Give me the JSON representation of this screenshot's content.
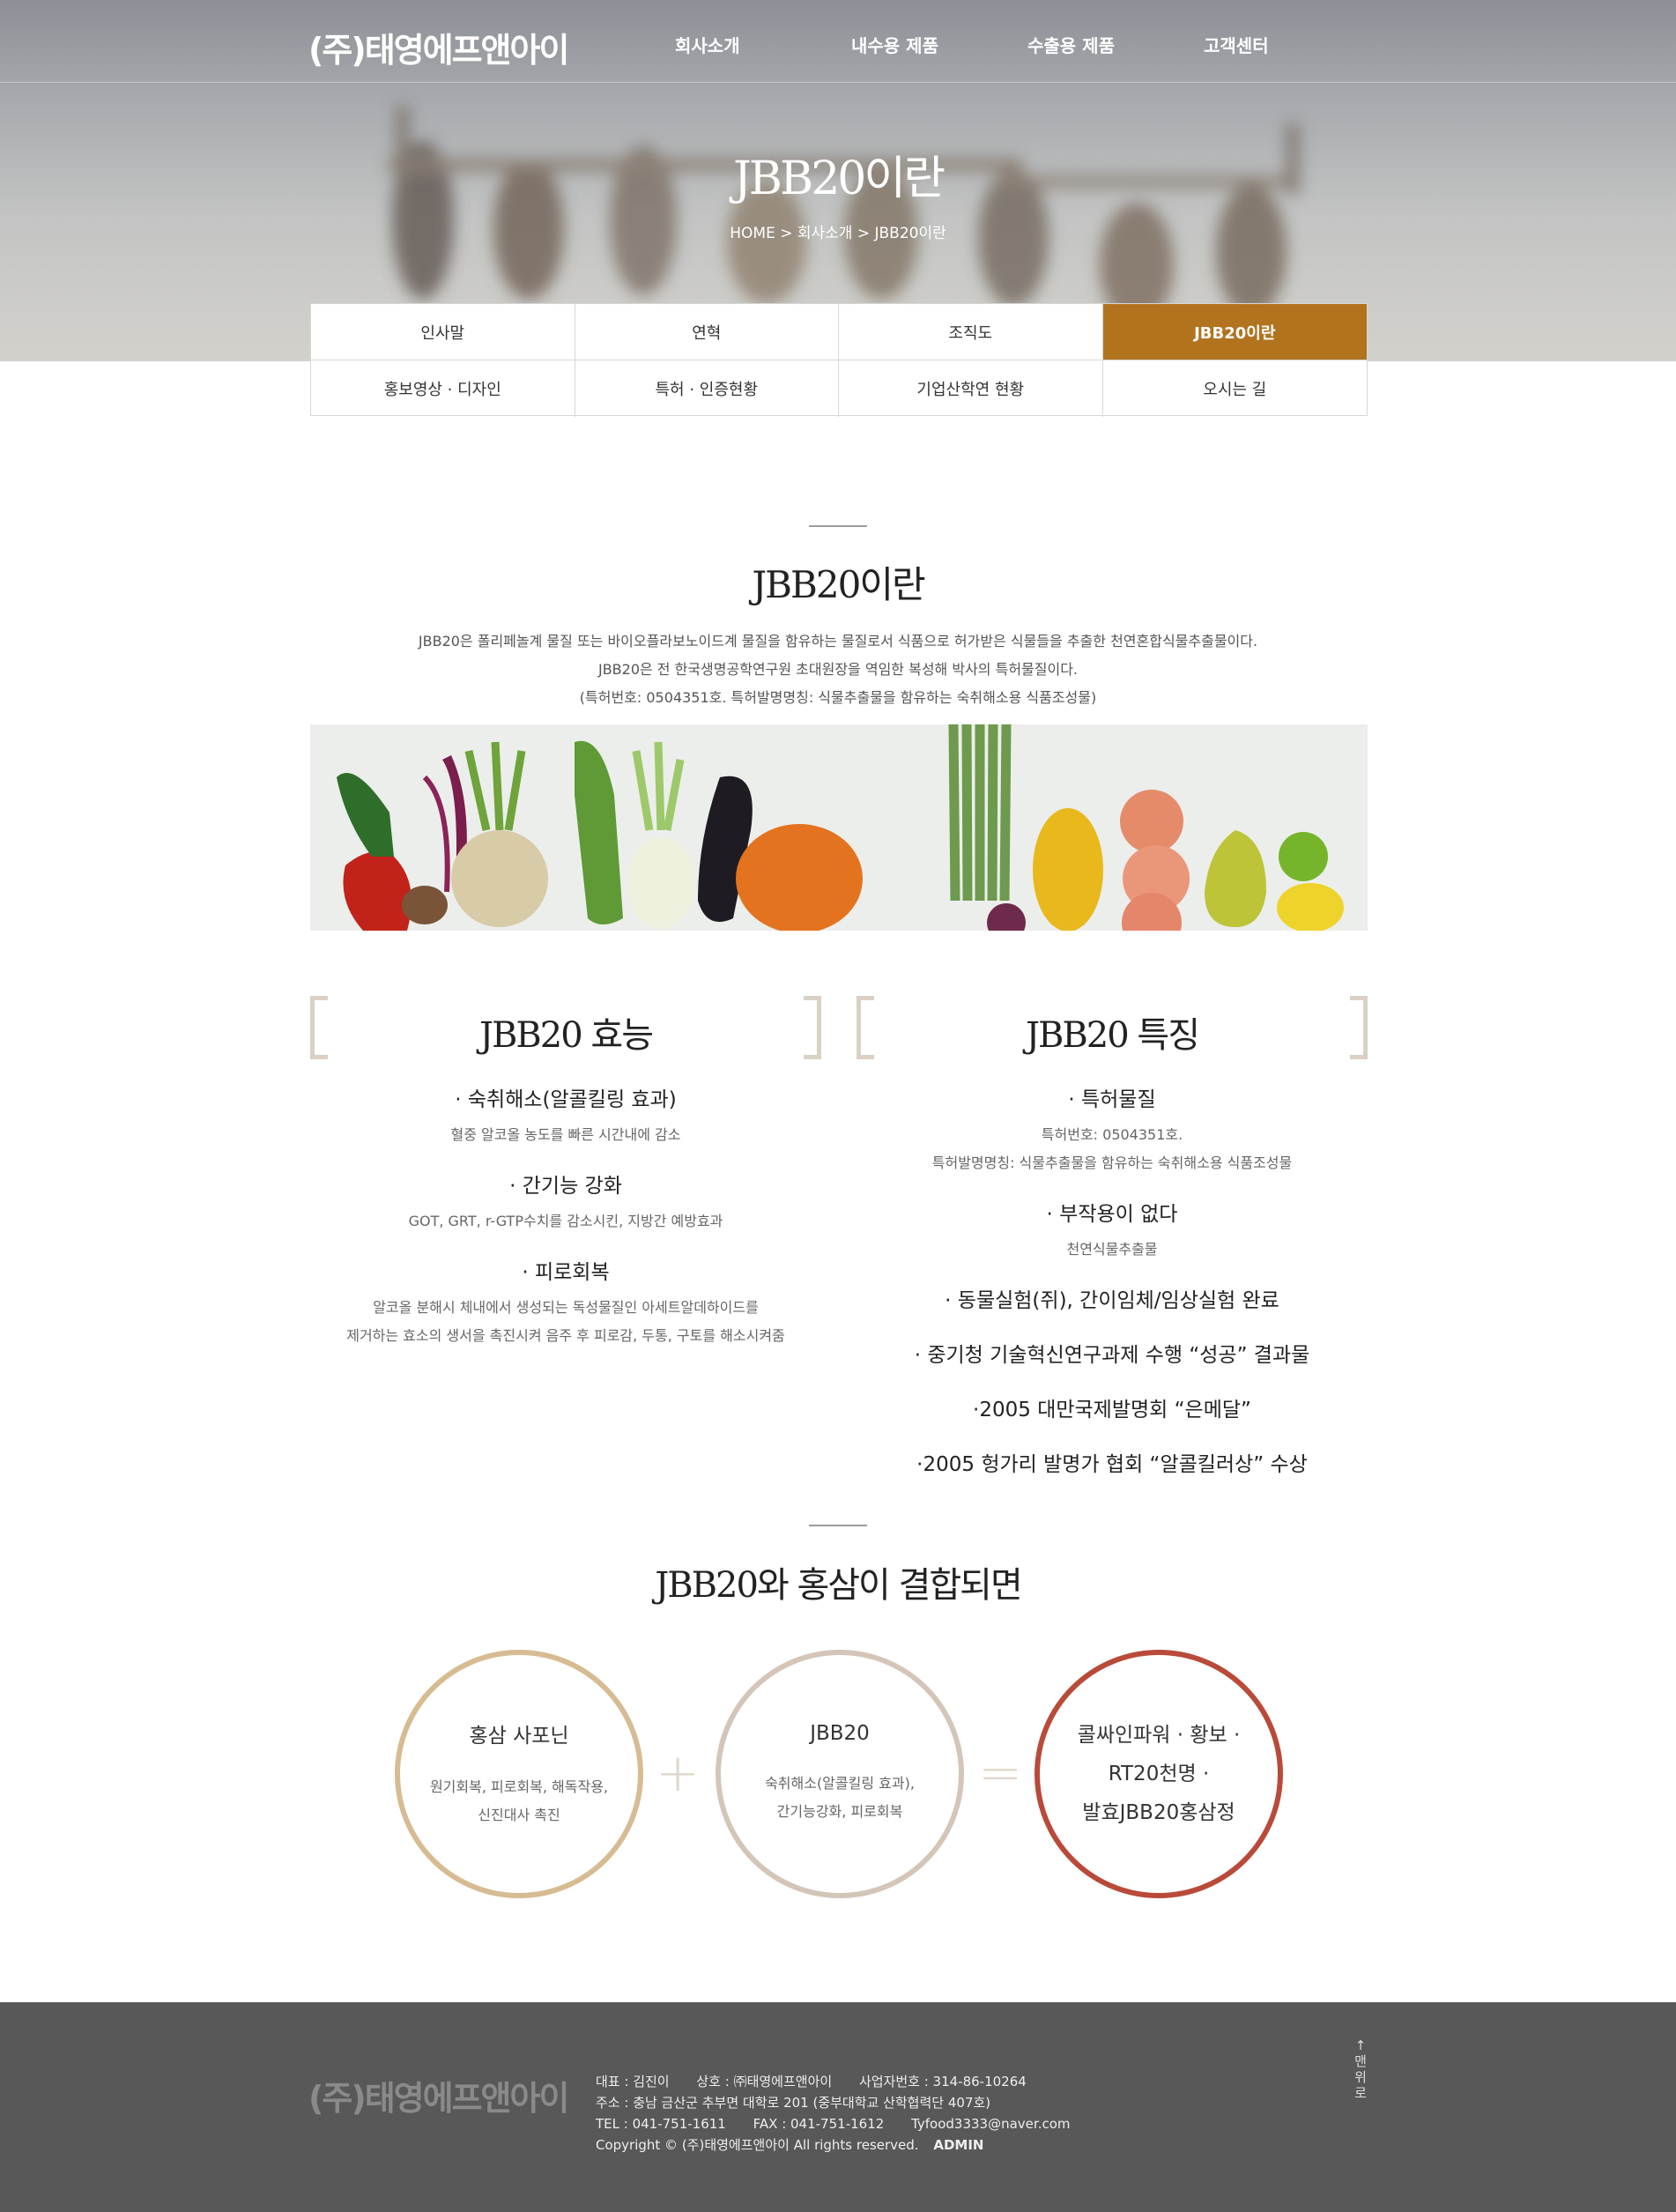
{
  "header": {
    "logo": "(주)태영에프앤아이",
    "nav": [
      "회사소개",
      "내수용 제품",
      "수출용 제품",
      "고객센터"
    ],
    "page_title": "JBB20이란",
    "breadcrumb": "HOME > 회사소개 > JBB20이란"
  },
  "submenu": {
    "items": [
      "인사말",
      "연혁",
      "조직도",
      "JBB20이란",
      "홍보영상 · 디자인",
      "특허 · 인증현황",
      "기업산학연 현황",
      "오시는 길"
    ],
    "active": "JBB20이란"
  },
  "intro": {
    "title": "JBB20이란",
    "lines": [
      "JBB20은 폴리페놀계 물질 또는 바이오플라보노이드계 물질을 함유하는 물질로서 식품으로 허가받은 식물들을 추출한 천연혼합식물추출물이다.",
      "JBB20은 전 한국생명공학연구원 초대원장을 역임한 복성해 박사의 특허물질이다.",
      "(특허번호: 0504351호. 특허발명명칭: 식물추출물을 함유하는 숙취해소용 식품조성물)"
    ]
  },
  "effects": {
    "title": "JBB20 효능",
    "items": [
      {
        "heading": "· 숙취해소(알콜킬링 효과)",
        "desc": [
          "혈중 알코올 농도를 빠른 시간내에 감소"
        ]
      },
      {
        "heading": "· 간기능 강화",
        "desc": [
          "GOT, GRT, r-GTP수치를 감소시킨, 지방간 예방효과"
        ]
      },
      {
        "heading": "· 피로회복",
        "desc": [
          "알코올 분해시 체내에서 생성되는 독성물질인 아세트알데하이드를",
          "제거하는 효소의 생서을 촉진시켜 음주 후 피로감, 두통, 구토를 해소시켜줌"
        ]
      }
    ]
  },
  "features": {
    "title": "JBB20 특징",
    "items": [
      {
        "heading": "· 특허물질",
        "desc": [
          "특허번호: 0504351호.",
          "특허발명명칭: 식물추출물을 함유하는 숙취해소용 식품조성물"
        ]
      },
      {
        "heading": "· 부작용이 없다",
        "desc": [
          "천연식물추출물"
        ]
      },
      {
        "heading": "· 동물실험(쥐), 간이임체/임상실험 완료",
        "desc": []
      },
      {
        "heading": "· 중기청 기술혁신연구과제 수행 “성공” 결과물",
        "desc": []
      },
      {
        "heading": "·2005 대만국제발명회 “은메달”",
        "desc": []
      },
      {
        "heading": "·2005 헝가리 발명가 협회 “알콜킬러상” 수상",
        "desc": []
      }
    ]
  },
  "combo": {
    "title": "JBB20와 홍삼이 결합되면",
    "circle1": {
      "title": "홍삼 사포닌",
      "lines": [
        "원기회복, 피로회복, 해독작용,",
        "신진대사 촉진"
      ]
    },
    "plus": "+",
    "circle2": {
      "title": "JBB20",
      "lines": [
        "숙취해소(알콜킬링 효과),",
        "간기능강화, 피로회복"
      ]
    },
    "equals": "=",
    "circle3": {
      "lines": [
        "콜싸인파워 · 황보 ·",
        "RT20천명 ·",
        "발효JBB20홍삼정"
      ]
    },
    "colors": {
      "circle1": "#d6bb93",
      "circle2": "#d3c6b8",
      "circle3": "#b94a3a"
    }
  },
  "footer": {
    "logo": "(주)태영에프앤아이",
    "ceo": "대표 : 김진이",
    "company": "상호 : ㈜태영에프앤아이",
    "bizno": "사업자번호 : 314-86-10264",
    "address": "주소 : 충남 금산군 추부면 대학로 201 (중부대학교 산학협력단 407호)",
    "tel": "TEL : 041-751-1611",
    "fax": "FAX : 041-751-1612",
    "email": "Tyfood3333@naver.com",
    "copyright": "Copyright © (주)태영에프앤아이 All rights reserved.",
    "admin": "ADMIN",
    "top_button": "↑맨위로"
  },
  "accent_color": "#b2731f"
}
